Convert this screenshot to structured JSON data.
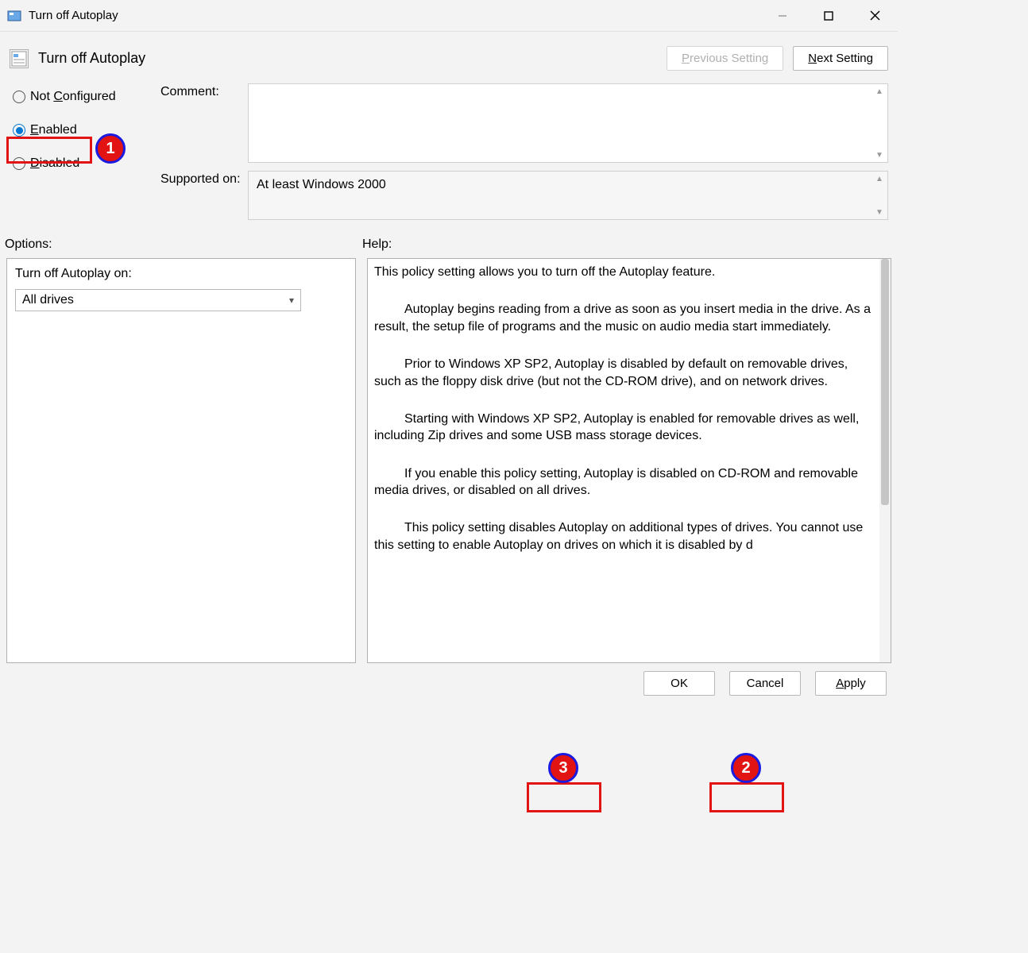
{
  "window": {
    "title": "Turn off Autoplay"
  },
  "header": {
    "policy_title": "Turn off Autoplay",
    "prev_label": "Previous Setting",
    "next_label": "Next Setting"
  },
  "radios": {
    "not_configured": "Not Configured",
    "enabled": "Enabled",
    "disabled": "Disabled"
  },
  "fields": {
    "comment_label": "Comment:",
    "comment_value": "",
    "supported_label": "Supported on:",
    "supported_value": "At least Windows 2000"
  },
  "sections": {
    "options_label": "Options:",
    "help_label": "Help:"
  },
  "options": {
    "label": "Turn off Autoplay on:",
    "selected": "All drives"
  },
  "help": {
    "p1": "This policy setting allows you to turn off the Autoplay feature.",
    "p2": "Autoplay begins reading from a drive as soon as you insert media in the drive. As a result, the setup file of programs and the music on audio media start immediately.",
    "p3": "Prior to Windows XP SP2, Autoplay is disabled by default on removable drives, such as the floppy disk drive (but not the CD-ROM drive), and on network drives.",
    "p4": "Starting with Windows XP SP2, Autoplay is enabled for removable drives as well, including Zip drives and some USB mass storage devices.",
    "p5": "If you enable this policy setting, Autoplay is disabled on CD-ROM and removable media drives, or disabled on all drives.",
    "p6a": "This policy setting disables Autoplay on additional types of drives. You cannot use this setting to enable Autoplay on drives on which it is disabled by d"
  },
  "footer": {
    "ok": "OK",
    "cancel": "Cancel",
    "apply": "Apply"
  },
  "annotations": {
    "n1": "1",
    "n2": "2",
    "n3": "3"
  }
}
